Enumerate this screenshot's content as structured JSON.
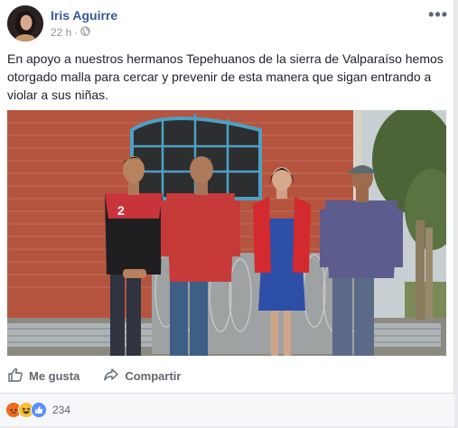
{
  "post": {
    "author": "Iris Aguirre",
    "time": "22 h",
    "separator": "·",
    "more_label": "•••",
    "text": "En apoyo a nuestros hermanos Tepehuanos de la sierra de Valparaíso hemos otorgado malla para cercar y prevenir de esta manera que sigan entrando a violar a sus niñas.",
    "privacy_icon": "globe-icon",
    "jersey_number": "2"
  },
  "actions": {
    "like_label": "Me gusta",
    "share_label": "Compartir"
  },
  "reactions": {
    "types": [
      "angry",
      "haha",
      "like"
    ],
    "count": "234"
  },
  "colors": {
    "author_link": "#365899",
    "like_blue": "#5890ff",
    "angry": "#e9710f",
    "haha": "#f7b125"
  }
}
